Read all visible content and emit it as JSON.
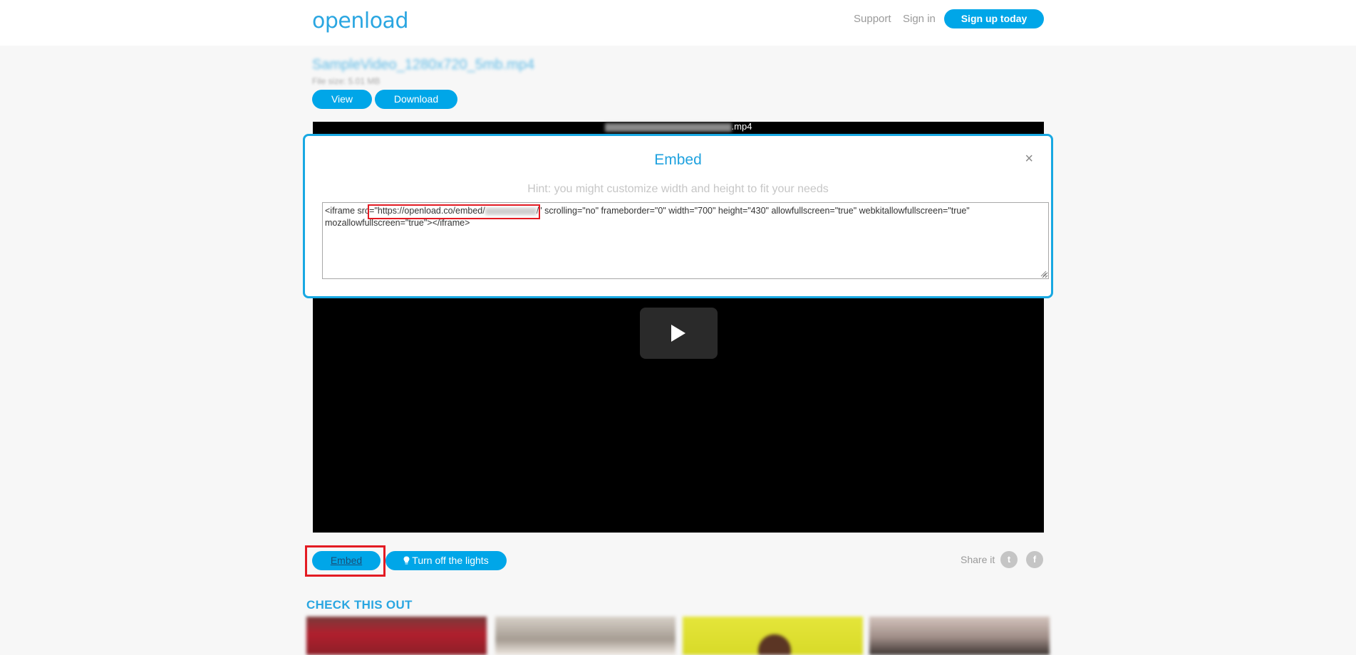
{
  "header": {
    "logo": "openload",
    "nav": {
      "support": "Support",
      "sign_in": "Sign in"
    },
    "signup_label": "Sign up today"
  },
  "file": {
    "name": "SampleVideo_1280x720_5mb.mp4",
    "size_text": "File size: 5.01 MB",
    "view_label": "View",
    "download_label": "Download"
  },
  "player": {
    "title_suffix": ".mp4"
  },
  "embed_modal": {
    "title": "Embed",
    "close_symbol": "×",
    "hint": "Hint: you might customize width and height to fit your needs",
    "code_prefix": "<iframe src=\"",
    "code_url": "https://openload.co/embed/",
    "code_url_end": "/",
    "code_suffix": "\" scrolling=\"no\" frameborder=\"0\" width=\"700\" height=\"430\" allowfullscreen=\"true\" webkitallowfullscreen=\"true\" mozallowfullscreen=\"true\"></iframe>"
  },
  "actions": {
    "embed_label": "Embed",
    "lights_label": "Turn off the lights",
    "share_label": "Share it",
    "twitter_glyph": "t",
    "facebook_glyph": "f"
  },
  "related": {
    "heading": "CHECK THIS OUT"
  },
  "colors": {
    "accent": "#00a6e8",
    "highlight": "#e31b23"
  }
}
